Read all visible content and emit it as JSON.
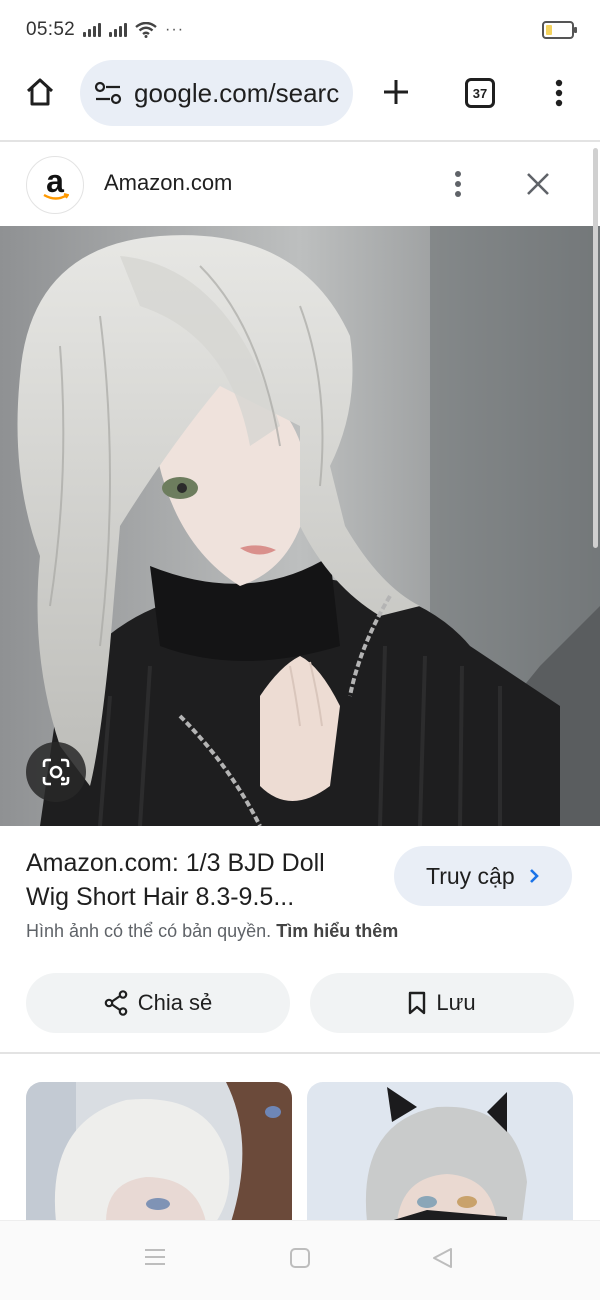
{
  "status_bar": {
    "time": "05:52",
    "more": "···"
  },
  "browser": {
    "url_display": "google.com/searc",
    "tab_count": "37"
  },
  "source": {
    "logo_letter": "a",
    "name": "Amazon.com"
  },
  "image": {
    "subject": "Doll with short silver-grey wig and black turtleneck sweater"
  },
  "result": {
    "title_line1": "Amazon.com: 1/3 BJD Doll",
    "title_line2": "Wig Short Hair 8.3-9.5...",
    "visit_label": "Truy cập",
    "copyright_text": "Hình ảnh có thể có bản quyền.",
    "learn_more": "Tìm hiểu thêm",
    "share_label": "Chia sẻ",
    "save_label": "Lưu"
  },
  "colors": {
    "accent_blue": "#1a73e8",
    "pill_bg": "#e9eef6",
    "action_bg": "#f1f3f4"
  }
}
